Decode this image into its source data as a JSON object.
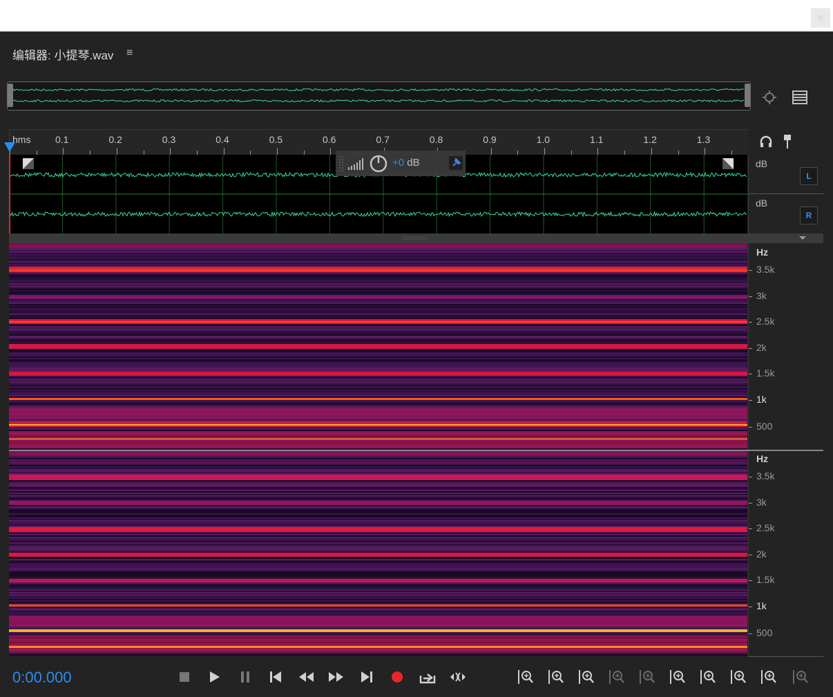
{
  "window": {
    "close_glyph": "×"
  },
  "panel": {
    "title": "编辑器: 小提琴.wav",
    "menu_glyph": "≡"
  },
  "timeline": {
    "unit_label": "hms",
    "ticks": [
      "0.1",
      "0.2",
      "0.3",
      "0.4",
      "0.5",
      "0.6",
      "0.7",
      "0.8",
      "0.9",
      "1.0",
      "1.1",
      "1.2",
      "1.3"
    ]
  },
  "hud": {
    "gain_prefix": "+0",
    "gain_unit": " dB"
  },
  "channels": {
    "left": {
      "scale_label": "dB",
      "button": "L"
    },
    "right": {
      "scale_label": "dB",
      "button": "R"
    }
  },
  "spectral": {
    "unit_label": "Hz",
    "labels": [
      "3.5k",
      "3k",
      "2.5k",
      "2k",
      "1.5k",
      "1k",
      "500"
    ]
  },
  "transport": {
    "time": "0:00.000"
  },
  "colors": {
    "accent": "#2d8ceb",
    "waveform": "#3ddc97",
    "record": "#e8262a"
  },
  "icons": {
    "overview": [
      "zoom-selection-icon",
      "spectral-view-icon"
    ],
    "ruler": [
      "headphones-icon",
      "marker-pin-icon"
    ],
    "transport": [
      "stop-icon",
      "play-icon",
      "pause-icon",
      "go-to-start-icon",
      "rewind-icon",
      "fast-forward-icon",
      "go-to-end-icon",
      "record-icon",
      "loop-playback-icon",
      "skip-silence-icon"
    ],
    "zoom": [
      "zoom-in-amplitude-icon",
      "zoom-out-amplitude-icon",
      "zoom-in-time-icon",
      "zoom-out-time-icon",
      "zoom-out-full-icon",
      "zoom-in-start-icon",
      "zoom-in-end-icon",
      "zoom-selection-icon",
      "zoom-reset-icon",
      "zoom-in-spectral-icon"
    ]
  }
}
